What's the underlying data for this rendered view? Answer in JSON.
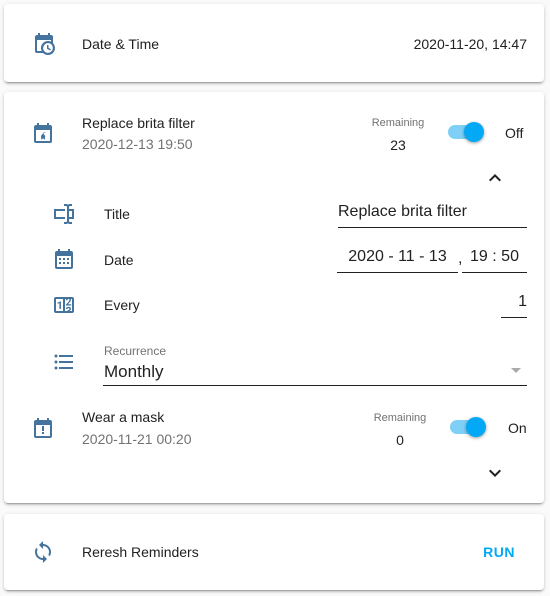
{
  "datetime_card": {
    "label": "Date & Time",
    "value": "2020-11-20, 14:47",
    "icon": "calendar-clock-icon"
  },
  "reminders": [
    {
      "title": "Replace brita filter",
      "date": "2020-12-13 19:50",
      "remaining_label": "Remaining",
      "remaining": "23",
      "state": "Off",
      "toggle_on": true,
      "expanded": true,
      "icon": "calendar-star-icon"
    },
    {
      "title": "Wear a mask",
      "date": "2020-11-21 00:20",
      "remaining_label": "Remaining",
      "remaining": "0",
      "state": "On",
      "toggle_on": true,
      "expanded": false,
      "icon": "calendar-alert-icon"
    }
  ],
  "editor": {
    "title_label": "Title",
    "title_value": "Replace brita filter",
    "date_label": "Date",
    "date_value": "2020 - 11 - 13",
    "time_value": "19 : 50",
    "date_sep": ",",
    "every_label": "Every",
    "every_value": "1",
    "recurrence_label": "Recurrence",
    "recurrence_value": "Monthly"
  },
  "refresh_card": {
    "label": "Reresh Reminders",
    "button": "RUN"
  },
  "colors": {
    "icon": "#44739e",
    "accent": "#03a9f4"
  }
}
